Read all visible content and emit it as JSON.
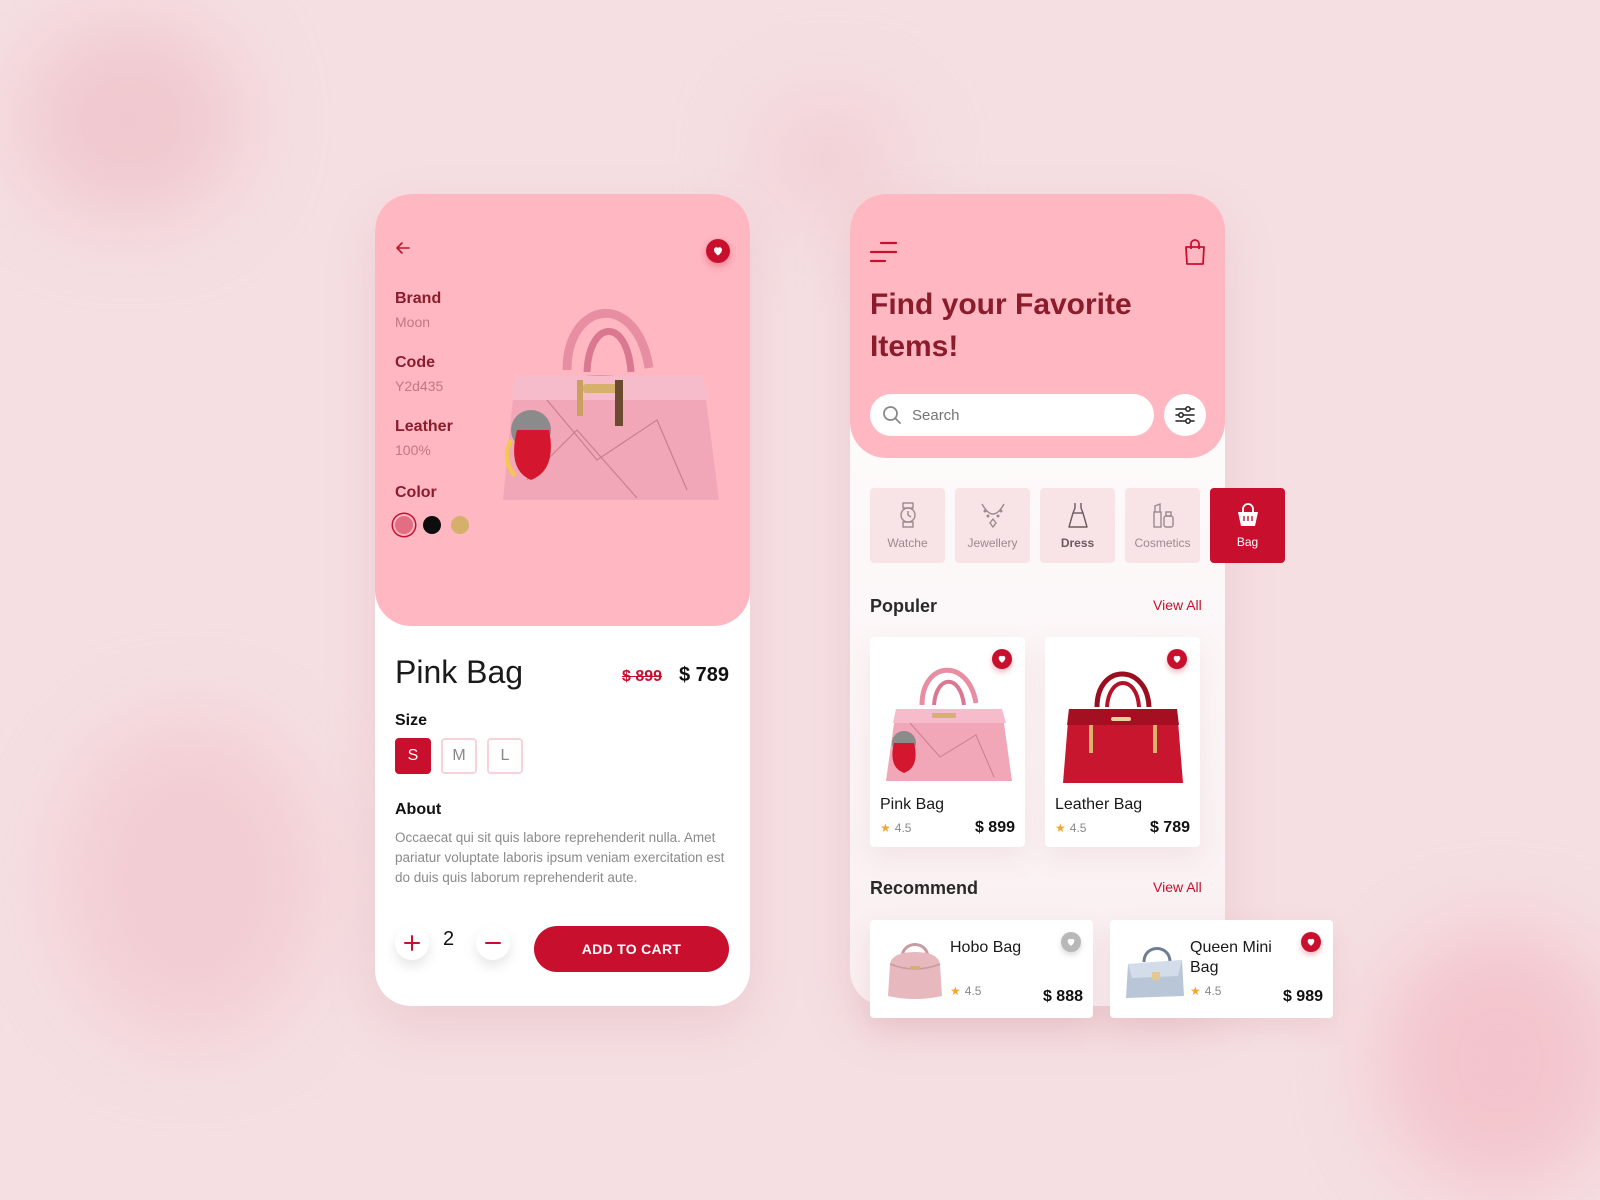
{
  "detail": {
    "brand_label": "Brand",
    "brand_value": "Moon",
    "code_label": "Code",
    "code_value": "Y2d435",
    "leather_label": "Leather",
    "leather_value": "100%",
    "color_label": "Color",
    "colors": [
      "#e36d83",
      "#0d0d0d",
      "#d4b06c"
    ],
    "title": "Pink Bag",
    "old_price": "$ 899",
    "new_price": "$ 789",
    "size_label": "Size",
    "sizes": [
      "S",
      "M",
      "L"
    ],
    "selected_size": "S",
    "about_label": "About",
    "about_text": "Occaecat qui sit quis labore reprehenderit nulla. Amet pariatur voluptate laboris ipsum veniam exercitation est do duis quis laborum reprehenderit aute.",
    "quantity": "2",
    "add_to_cart": "ADD TO CART"
  },
  "shop": {
    "title": "Find your Favorite Items!",
    "search_placeholder": "Search",
    "categories": [
      {
        "label": "Watche",
        "icon": "watch-icon"
      },
      {
        "label": "Jewellery",
        "icon": "necklace-icon"
      },
      {
        "label": "Dress",
        "icon": "dress-icon"
      },
      {
        "label": "Cosmetics",
        "icon": "cosmetics-icon"
      },
      {
        "label": "Bag",
        "icon": "bag-icon"
      }
    ],
    "popular_title": "Populer",
    "recommend_title": "Recommend",
    "view_all": "View All",
    "popular": [
      {
        "name": "Pink Bag",
        "rating": "4.5",
        "price": "$ 899"
      },
      {
        "name": "Leather Bag",
        "rating": "4.5",
        "price": "$ 789"
      }
    ],
    "recommend": [
      {
        "name": "Hobo Bag",
        "rating": "4.5",
        "price": "$ 888"
      },
      {
        "name": "Queen Mini Bag",
        "rating": "4.5",
        "price": "$ 989"
      }
    ]
  },
  "colors": {
    "accent": "#c8102e",
    "header_pink": "#ffb8c2",
    "background": "#f5dfe2"
  }
}
